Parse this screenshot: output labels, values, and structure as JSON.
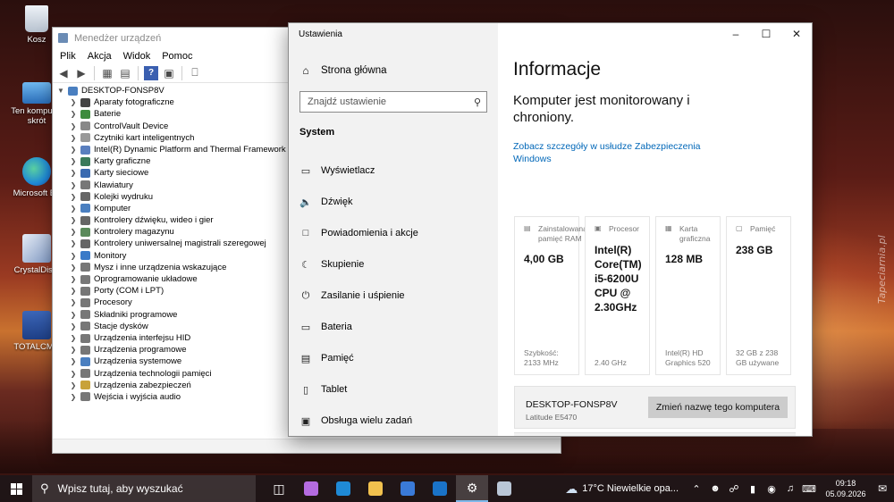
{
  "desktop": {
    "icons": [
      {
        "label": "Kosz",
        "color": "#d7dde6"
      },
      {
        "label": "Ten komputer\nskrót",
        "line1": "Ten komputer",
        "line2": "skrót",
        "color": "#3c8fd6"
      },
      {
        "label": "Microsoft Ed",
        "color": "#1f8ad6"
      },
      {
        "label": "CrystalDiskI",
        "color": "#8fa5c9"
      },
      {
        "label": "TOTALCMD",
        "color": "#2e57a8"
      }
    ],
    "watermark": "Tapeciarnia.pl"
  },
  "device_manager": {
    "title": "Menedżer urządzeń",
    "menu": [
      "Plik",
      "Akcja",
      "Widok",
      "Pomoc"
    ],
    "root": "DESKTOP-FONSP8V",
    "items": [
      {
        "label": "Aparaty fotograficzne",
        "icon": "camera-icon",
        "color": "#444"
      },
      {
        "label": "Baterie",
        "icon": "battery-icon",
        "color": "#3d8c3d"
      },
      {
        "label": "ControlVault Device",
        "icon": "security-device-icon",
        "color": "#888"
      },
      {
        "label": "Czytniki kart inteligentnych",
        "icon": "smartcard-reader-icon",
        "color": "#999"
      },
      {
        "label": "Intel(R) Dynamic Platform and Thermal Framework",
        "icon": "thermal-icon",
        "color": "#5a7fbf"
      },
      {
        "label": "Karty graficzne",
        "icon": "display-adapter-icon",
        "color": "#3a7a5a"
      },
      {
        "label": "Karty sieciowe",
        "icon": "network-adapter-icon",
        "color": "#3a6ab0"
      },
      {
        "label": "Klawiatury",
        "icon": "keyboard-icon",
        "color": "#777"
      },
      {
        "label": "Kolejki wydruku",
        "icon": "printer-icon",
        "color": "#666"
      },
      {
        "label": "Komputer",
        "icon": "computer-icon",
        "color": "#4a7fc0"
      },
      {
        "label": "Kontrolery dźwięku, wideo i gier",
        "icon": "sound-icon",
        "color": "#666"
      },
      {
        "label": "Kontrolery magazynu",
        "icon": "storage-controller-icon",
        "color": "#5a8a5a"
      },
      {
        "label": "Kontrolery uniwersalnej magistrali szeregowej",
        "icon": "usb-icon",
        "color": "#666"
      },
      {
        "label": "Monitory",
        "icon": "monitor-icon",
        "color": "#3a7ac8"
      },
      {
        "label": "Mysz i inne urządzenia wskazujące",
        "icon": "mouse-icon",
        "color": "#777"
      },
      {
        "label": "Oprogramowanie układowe",
        "icon": "firmware-icon",
        "color": "#777"
      },
      {
        "label": "Porty (COM i LPT)",
        "icon": "port-icon",
        "color": "#777"
      },
      {
        "label": "Procesory",
        "icon": "processor-icon",
        "color": "#777"
      },
      {
        "label": "Składniki programowe",
        "icon": "software-component-icon",
        "color": "#777"
      },
      {
        "label": "Stacje dysków",
        "icon": "disk-drive-icon",
        "color": "#777"
      },
      {
        "label": "Urządzenia interfejsu HID",
        "icon": "hid-icon",
        "color": "#777"
      },
      {
        "label": "Urządzenia programowe",
        "icon": "software-device-icon",
        "color": "#777"
      },
      {
        "label": "Urządzenia systemowe",
        "icon": "system-device-icon",
        "color": "#4a7fc0"
      },
      {
        "label": "Urządzenia technologii pamięci",
        "icon": "memory-tech-icon",
        "color": "#777"
      },
      {
        "label": "Urządzenia zabezpieczeń",
        "icon": "security-icon",
        "color": "#c8a23a"
      },
      {
        "label": "Wejścia i wyjścia audio",
        "icon": "audio-io-icon",
        "color": "#777"
      }
    ]
  },
  "settings": {
    "window_title": "Ustawienia",
    "nav": {
      "home": "Strona główna",
      "search_placeholder": "Znajdź ustawienie",
      "section": "System",
      "items": [
        {
          "label": "Wyświetlacz",
          "icon": "display-icon"
        },
        {
          "label": "Dźwięk",
          "icon": "speaker-icon"
        },
        {
          "label": "Powiadomienia i akcje",
          "icon": "notification-icon"
        },
        {
          "label": "Skupienie",
          "icon": "focus-moon-icon"
        },
        {
          "label": "Zasilanie i uśpienie",
          "icon": "power-icon"
        },
        {
          "label": "Bateria",
          "icon": "battery-icon"
        },
        {
          "label": "Pamięć",
          "icon": "storage-icon"
        },
        {
          "label": "Tablet",
          "icon": "tablet-icon"
        },
        {
          "label": "Obsługa wielu zadań",
          "icon": "multitasking-icon"
        }
      ]
    },
    "content": {
      "heading": "Informacje",
      "protected": "Komputer jest monitorowany i chroniony.",
      "link": "Zobacz szczegóły w usłudze Zabezpieczenia Windows",
      "cards": [
        {
          "title": "Zainstalowana pamięć RAM",
          "value": "4,00 GB",
          "footer": "Szybkość: 2133 MHz",
          "icon": "ram-icon"
        },
        {
          "title": "Procesor",
          "value": "Intel(R) Core(TM) i5-6200U CPU @ 2.30GHz",
          "footer": "2.40 GHz",
          "icon": "cpu-icon"
        },
        {
          "title": "Karta graficzna",
          "value": "128 MB",
          "footer": "Intel(R) HD Graphics 520",
          "icon": "gpu-icon"
        },
        {
          "title": "Pamięć",
          "value": "238 GB",
          "footer": "32 GB z 238 GB używane",
          "icon": "storage-icon"
        }
      ],
      "pc_name": "DESKTOP-FONSP8V",
      "pc_model": "Latitude E5470",
      "rename_button": "Zmień nazwę tego komputera"
    }
  },
  "taskbar": {
    "search_placeholder": "Wpisz tutaj, aby wyszukać",
    "weather": "17°C  Niewielkie opa...",
    "time": "09:18",
    "date": "05.09.2026",
    "apps": [
      {
        "name": "task-view",
        "color": "#ffffff"
      },
      {
        "name": "copilot",
        "color": "#b46be0"
      },
      {
        "name": "edge",
        "color": "#1f8ad6"
      },
      {
        "name": "explorer",
        "color": "#f2c14e"
      },
      {
        "name": "store",
        "color": "#3a7ad8"
      },
      {
        "name": "outlook",
        "color": "#1a73c8"
      },
      {
        "name": "settings",
        "color": "#ffffff"
      },
      {
        "name": "device-manager",
        "color": "#b9c6d6"
      }
    ]
  }
}
